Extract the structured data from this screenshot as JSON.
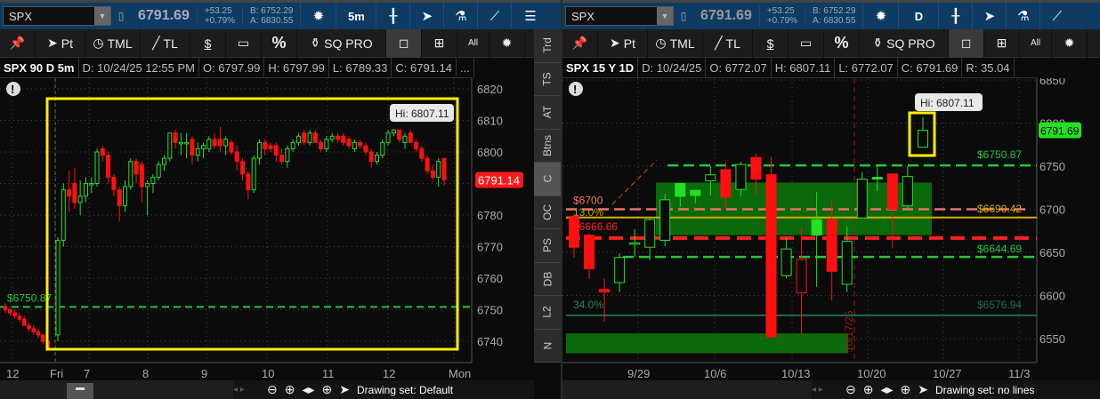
{
  "left": {
    "symbol": "SPX",
    "last": "6791.69",
    "change": "+53.25",
    "change_pct": "+0.79%",
    "bid": "B: 6752.29",
    "ask": "A: 6830.55",
    "timeframe": "5m",
    "tools": {
      "pin": "",
      "pt": "Pt",
      "tml": "TML",
      "tl": "TL",
      "dollar": "$",
      "pct": "%",
      "sqpro": "SQ PRO",
      "all": "All"
    },
    "info": {
      "title": "SPX 90 D 5m",
      "date": "D: 10/24/25 12:55 PM",
      "open": "O: 6797.99",
      "high": "H: 6797.99",
      "low": "L: 6789.33",
      "close": "C: 6791.14",
      "more": "..."
    },
    "side_tabs": [
      "Trd",
      "TS",
      "AT",
      "Btns",
      "C",
      "OC",
      "PS",
      "DB",
      "L2",
      "N"
    ],
    "drawing_set": "Drawing set: Default"
  },
  "right": {
    "symbol": "SPX",
    "last": "6791.69",
    "change": "+53.25",
    "change_pct": "+0.79%",
    "bid": "B: 6752.29",
    "ask": "A: 6830.55",
    "timeframe": "D",
    "tools": {
      "pt": "Pt",
      "tml": "TML",
      "tl": "TL",
      "dollar": "$",
      "pct": "%",
      "sqpro": "SQ PRO",
      "all": "All"
    },
    "info": {
      "title": "SPX 15 Y 1D",
      "date": "D: 10/24/25",
      "open": "O: 6772.07",
      "high": "H: 6807.11",
      "low": "L: 6772.07",
      "close": "C: 6791.69",
      "rsi": "R: 35.04"
    },
    "drawing_set": "Drawing set: no lines"
  },
  "chart_data": [
    {
      "type": "candlestick",
      "title": "SPX 90 D 5m",
      "ylim": [
        6735,
        6825
      ],
      "yticks": [
        "6740",
        "6750",
        "6760",
        "6770",
        "6780",
        "6790",
        "6800",
        "6810",
        "6820"
      ],
      "xticks": [
        "12",
        "Fri",
        "7",
        "8",
        "9",
        "10",
        "11",
        "12",
        "Mon"
      ],
      "price_badge": "6791.14",
      "hi_label": "Hi: 6807.11",
      "level": {
        "label": "$6750.87",
        "value": 6750.87
      },
      "prev_session_ohlc": [
        [
          6751,
          6752,
          6749,
          6750
        ],
        [
          6750,
          6751,
          6748,
          6749
        ],
        [
          6749,
          6750,
          6747,
          6748
        ],
        [
          6748,
          6749,
          6746,
          6747
        ],
        [
          6747,
          6748,
          6745,
          6745
        ],
        [
          6745,
          6746,
          6743,
          6744
        ],
        [
          6744,
          6745,
          6742,
          6743
        ],
        [
          6743,
          6744,
          6741,
          6742
        ],
        [
          6742,
          6742,
          6739,
          6740
        ],
        [
          6740,
          6741,
          6738,
          6738
        ]
      ],
      "ohlc": [
        [
          6742,
          6773,
          6740,
          6772
        ],
        [
          6772,
          6790,
          6770,
          6788
        ],
        [
          6788,
          6794,
          6781,
          6786
        ],
        [
          6790,
          6795,
          6782,
          6784
        ],
        [
          6784,
          6791,
          6780,
          6786
        ],
        [
          6786,
          6792,
          6784,
          6790
        ],
        [
          6790,
          6792,
          6787,
          6790
        ],
        [
          6790,
          6801,
          6789,
          6800
        ],
        [
          6801,
          6802,
          6797,
          6799
        ],
        [
          6799,
          6800,
          6790,
          6792
        ],
        [
          6792,
          6793,
          6786,
          6788
        ],
        [
          6788,
          6789,
          6778,
          6783
        ],
        [
          6783,
          6791,
          6781,
          6789
        ],
        [
          6789,
          6798,
          6788,
          6797
        ],
        [
          6797,
          6798,
          6790,
          6793
        ],
        [
          6796,
          6797,
          6784,
          6789
        ],
        [
          6789,
          6791,
          6780,
          6790
        ],
        [
          6790,
          6793,
          6787,
          6792
        ],
        [
          6792,
          6797,
          6791,
          6796
        ],
        [
          6796,
          6799,
          6794,
          6798
        ],
        [
          6798,
          6806,
          6797,
          6806
        ],
        [
          6806,
          6807,
          6801,
          6803
        ],
        [
          6803,
          6806,
          6799,
          6803
        ],
        [
          6803,
          6806,
          6798,
          6803
        ],
        [
          6804,
          6805,
          6796,
          6799
        ],
        [
          6799,
          6803,
          6797,
          6801
        ],
        [
          6801,
          6803,
          6798,
          6802
        ],
        [
          6801,
          6805,
          6800,
          6804
        ],
        [
          6804,
          6806,
          6801,
          6802
        ],
        [
          6804,
          6808,
          6800,
          6802
        ],
        [
          6802,
          6805,
          6799,
          6804
        ],
        [
          6803,
          6804,
          6799,
          6800
        ],
        [
          6800,
          6802,
          6794,
          6797
        ],
        [
          6797,
          6798,
          6791,
          6793
        ],
        [
          6793,
          6794,
          6785,
          6788
        ],
        [
          6788,
          6799,
          6787,
          6798
        ],
        [
          6798,
          6804,
          6796,
          6803
        ],
        [
          6803,
          6804,
          6799,
          6801
        ],
        [
          6802,
          6803,
          6800,
          6801
        ],
        [
          6802,
          6803,
          6797,
          6799
        ],
        [
          6799,
          6801,
          6796,
          6797
        ],
        [
          6797,
          6802,
          6795,
          6801
        ],
        [
          6801,
          6804,
          6800,
          6803
        ],
        [
          6803,
          6806,
          6802,
          6805
        ],
        [
          6806,
          6807,
          6802,
          6803
        ],
        [
          6803,
          6807,
          6802,
          6806
        ],
        [
          6806,
          6807,
          6803,
          6803
        ],
        [
          6803,
          6804,
          6800,
          6801
        ],
        [
          6801,
          6805,
          6800,
          6804
        ],
        [
          6804,
          6806,
          6803,
          6805
        ],
        [
          6805,
          6806,
          6803,
          6804
        ],
        [
          6805,
          6806,
          6802,
          6803
        ],
        [
          6804,
          6805,
          6801,
          6802
        ],
        [
          6801,
          6804,
          6800,
          6803
        ],
        [
          6803,
          6804,
          6801,
          6802
        ],
        [
          6802,
          6803,
          6799,
          6800
        ],
        [
          6800,
          6801,
          6795,
          6797
        ],
        [
          6797,
          6800,
          6796,
          6799
        ],
        [
          6799,
          6804,
          6798,
          6803
        ],
        [
          6803,
          6807,
          6802,
          6806
        ],
        [
          6806,
          6807.11,
          6805,
          6807
        ],
        [
          6807,
          6807,
          6803,
          6804
        ],
        [
          6803,
          6806,
          6801,
          6805
        ],
        [
          6806,
          6807,
          6803,
          6803
        ],
        [
          6803,
          6804,
          6800,
          6801
        ],
        [
          6801,
          6802,
          6797,
          6798
        ],
        [
          6798,
          6799,
          6793,
          6794
        ],
        [
          6794,
          6796,
          6791,
          6792
        ],
        [
          6792,
          6798,
          6789,
          6797
        ],
        [
          6797.99,
          6797.99,
          6789.33,
          6791.14
        ]
      ]
    },
    {
      "type": "candlestick",
      "title": "SPX 15 Y 1D",
      "ylim": [
        6520,
        6860
      ],
      "yticks": [
        "6550",
        "6600",
        "6650",
        "6700",
        "6750",
        "6800",
        "6850"
      ],
      "xticks": [
        "9/29",
        "10/6",
        "10/13",
        "10/20",
        "10/27",
        "11/3"
      ],
      "price_badge": "6791.69",
      "hi_label": "Hi: 6807.11",
      "vline_label": "10/17/25",
      "levels": [
        {
          "label": "$6750.87",
          "value": 6750.87,
          "color": "#1ec83c",
          "style": "dashed"
        },
        {
          "label": "$6700",
          "value": 6700,
          "color": "#f07070",
          "style": "dashed"
        },
        {
          "label": "$6690.42",
          "value": 6690.42,
          "color": "#d4b000",
          "style": "solid"
        },
        {
          "label": "$6666.66",
          "value": 6666.66,
          "color": "#ff2020",
          "style": "thick-dashed"
        },
        {
          "label": "$6644.69",
          "value": 6644.69,
          "color": "#1ec83c",
          "style": "dashed"
        },
        {
          "label": "$6576.94",
          "value": 6576.94,
          "color": "#1b6e4a",
          "style": "solid"
        }
      ],
      "pct_labels": [
        "13.0%",
        "34.0%"
      ],
      "zones": [
        {
          "from": 6670,
          "to": 6731
        },
        {
          "from": 6533,
          "to": 6556
        }
      ],
      "ohlc": [
        [
          6692,
          6695,
          6644,
          6656
        ],
        [
          6670,
          6672,
          6619,
          6631
        ],
        [
          6607,
          6620,
          6570,
          6604
        ],
        [
          6615,
          6649,
          6604,
          6644
        ],
        [
          6660,
          6677,
          6645,
          6661
        ],
        [
          6656,
          6690,
          6641,
          6688
        ],
        [
          6664,
          6718,
          6657,
          6711
        ],
        [
          6715,
          6730,
          6703,
          6730
        ],
        [
          6716,
          6722,
          6707,
          6722
        ],
        [
          6733,
          6750,
          6716,
          6740
        ],
        [
          6746,
          6754,
          6700,
          6714
        ],
        [
          6723,
          6755,
          6715,
          6752
        ],
        [
          6760,
          6765,
          6717,
          6735
        ],
        [
          6740,
          6761,
          6552,
          6552
        ],
        [
          6623,
          6667,
          6620,
          6654
        ],
        [
          6642,
          6680,
          6555,
          6603
        ],
        [
          6670,
          6720,
          6610,
          6688
        ],
        [
          6688,
          6710,
          6594,
          6628
        ],
        [
          6613,
          6680,
          6604,
          6663
        ],
        [
          6690,
          6743,
          6690,
          6735
        ],
        [
          6735,
          6752,
          6721,
          6737
        ],
        [
          6741,
          6741,
          6655,
          6700
        ],
        [
          6704,
          6750,
          6700,
          6738
        ],
        [
          6772.07,
          6807.11,
          6772.07,
          6791.69
        ]
      ],
      "filled_up": [
        7,
        8,
        16,
        20
      ],
      "hollow_down": [
        15
      ]
    }
  ],
  "colors": {
    "up": "#22e022",
    "down": "#ff1010",
    "highlight": "#ffee00",
    "topbar": "#0d3b62"
  }
}
